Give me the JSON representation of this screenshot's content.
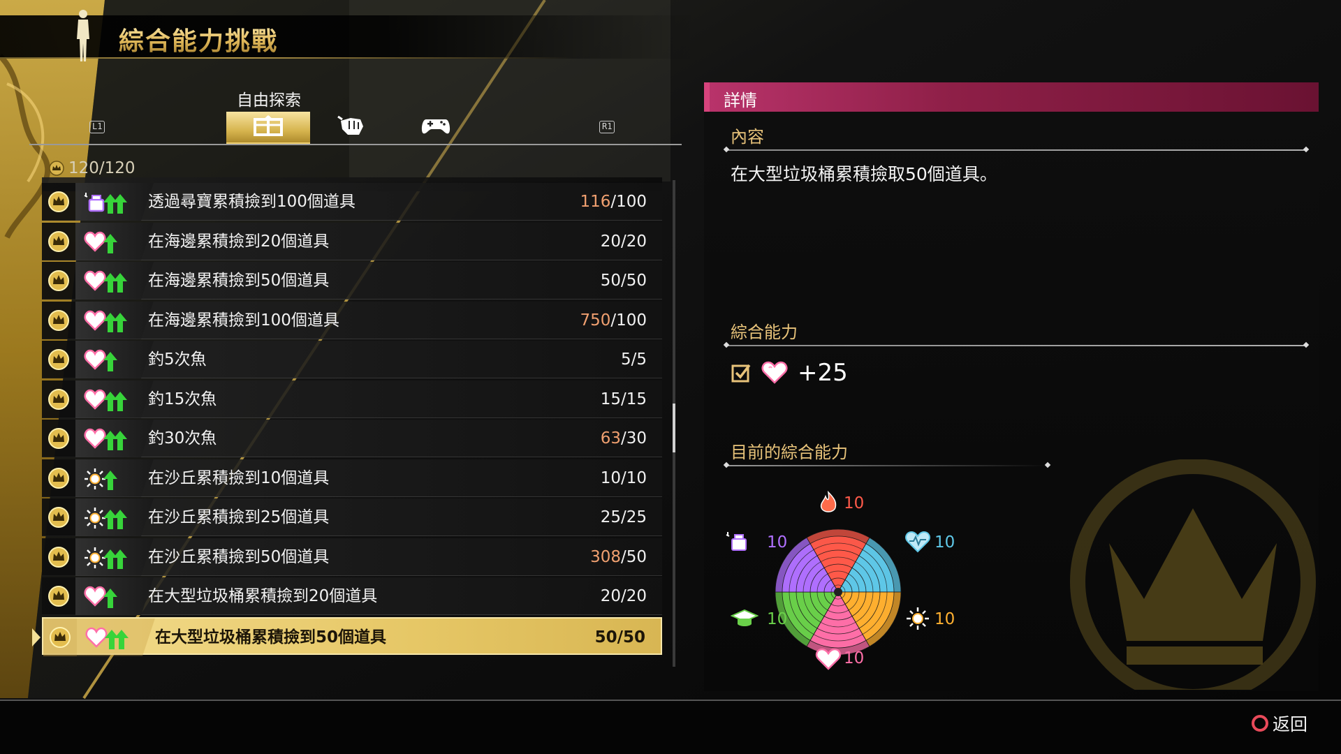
{
  "header": {
    "title": "綜合能力挑戰"
  },
  "tabs": {
    "caption": "自由探索",
    "left_key": "L1",
    "right_key": "R1",
    "items": [
      {
        "name": "tab-collect",
        "glyph": "⼊",
        "icon": "collect-icon",
        "active": true
      },
      {
        "name": "tab-fight",
        "glyph": "✊",
        "icon": "fist-icon",
        "active": false
      },
      {
        "name": "tab-minigame",
        "glyph": "🎮",
        "icon": "gamepad-icon",
        "active": false
      }
    ]
  },
  "list": {
    "count": "120/120",
    "rows": [
      {
        "stat_icon": "charm-icon",
        "arrows": 2,
        "label": "透過尋寶累積撿到100個道具",
        "current": "116",
        "target": "100",
        "over": true
      },
      {
        "stat_icon": "kindness-icon",
        "arrows": 1,
        "label": "在海邊累積撿到20個道具",
        "current": "20",
        "target": "20",
        "over": false
      },
      {
        "stat_icon": "kindness-icon",
        "arrows": 2,
        "label": "在海邊累積撿到50個道具",
        "current": "50",
        "target": "50",
        "over": false
      },
      {
        "stat_icon": "kindness-icon",
        "arrows": 2,
        "label": "在海邊累積撿到100個道具",
        "current": "750",
        "target": "100",
        "over": true
      },
      {
        "stat_icon": "kindness-icon",
        "arrows": 1,
        "label": "釣5次魚",
        "current": "5",
        "target": "5",
        "over": false
      },
      {
        "stat_icon": "kindness-icon",
        "arrows": 2,
        "label": "釣15次魚",
        "current": "15",
        "target": "15",
        "over": false
      },
      {
        "stat_icon": "kindness-icon",
        "arrows": 2,
        "label": "釣30次魚",
        "current": "63",
        "target": "30",
        "over": true
      },
      {
        "stat_icon": "style-icon",
        "arrows": 1,
        "label": "在沙丘累積撿到10個道具",
        "current": "10",
        "target": "10",
        "over": false
      },
      {
        "stat_icon": "style-icon",
        "arrows": 2,
        "label": "在沙丘累積撿到25個道具",
        "current": "25",
        "target": "25",
        "over": false
      },
      {
        "stat_icon": "style-icon",
        "arrows": 2,
        "label": "在沙丘累積撿到50個道具",
        "current": "308",
        "target": "50",
        "over": true
      },
      {
        "stat_icon": "kindness-icon",
        "arrows": 1,
        "label": "在大型垃圾桶累積撿到20個道具",
        "current": "20",
        "target": "20",
        "over": false
      },
      {
        "stat_icon": "kindness-icon",
        "arrows": 2,
        "label": "在大型垃圾桶累積撿到50個道具",
        "current": "50",
        "target": "50",
        "over": false,
        "selected": true
      }
    ]
  },
  "detail": {
    "header": "詳情",
    "content_title": "內容",
    "description": "在大型垃圾桶累積撿取50個道具。",
    "ability_title": "綜合能力",
    "reward_value": "+25",
    "current_title": "目前的綜合能力",
    "wheel": {
      "passion": {
        "value": "10",
        "color": "#ff5a4a"
      },
      "confidence": {
        "value": "10",
        "color": "#5fc8e8"
      },
      "style": {
        "value": "10",
        "color": "#ffb030"
      },
      "kindness": {
        "value": "10",
        "color": "#ff6fa8"
      },
      "intelligence": {
        "value": "10",
        "color": "#6ad04a"
      },
      "charm": {
        "value": "10",
        "color": "#b070ff"
      }
    }
  },
  "footer": {
    "back_label": "返回"
  },
  "colors": {
    "accent_gold": "#e6c766",
    "panel_header": "#8e1f47",
    "over_value": "#f0a070"
  }
}
